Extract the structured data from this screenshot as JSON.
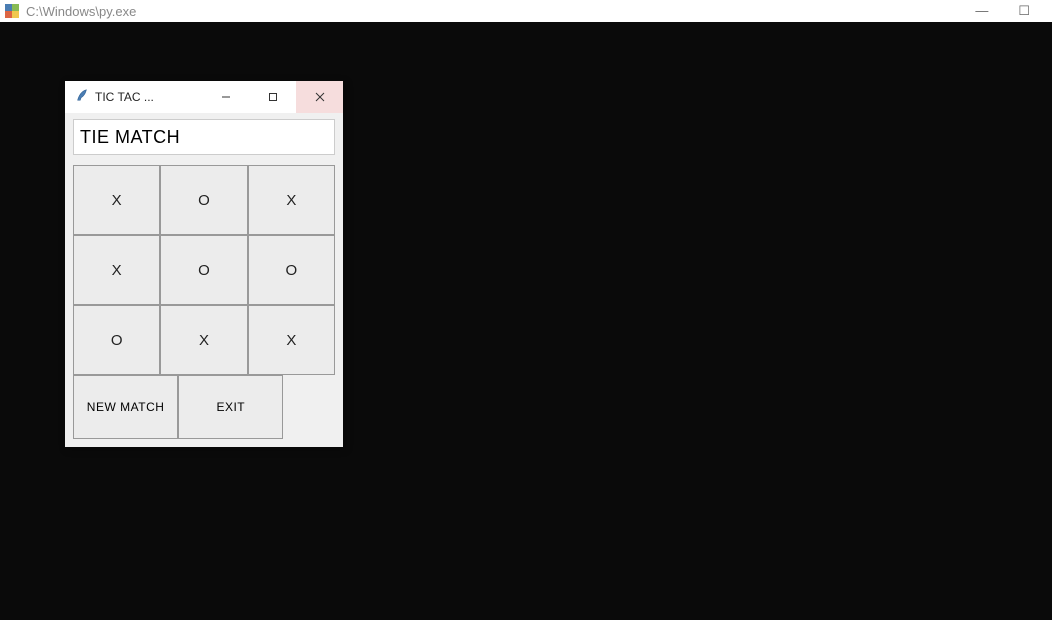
{
  "outer": {
    "title": "C:\\Windows\\py.exe"
  },
  "game": {
    "title": "TIC TAC ...",
    "status": "TIE MATCH",
    "board": [
      [
        "X",
        "O",
        "X"
      ],
      [
        "X",
        "O",
        "O"
      ],
      [
        "O",
        "X",
        "X"
      ]
    ],
    "buttons": {
      "new_match": "NEW MATCH",
      "exit": "EXIT"
    }
  }
}
